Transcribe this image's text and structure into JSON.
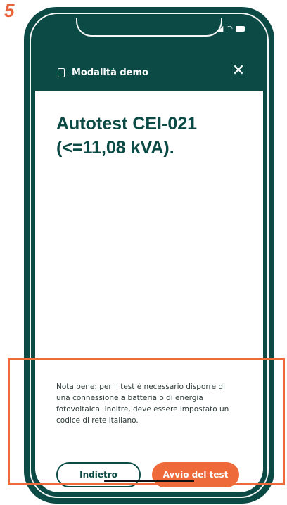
{
  "step": {
    "number": "5"
  },
  "header": {
    "icon": "document-icon",
    "label": "Modalità demo",
    "close_icon": "close-icon"
  },
  "main": {
    "title_line1": "Autotest CEI-021",
    "title_line2": "(<=11,08 kVA).",
    "note": "Nota bene: per il test è necessario disporre di una connessione a batteria o di energia fotovoltaica. Inoltre, deve essere impostato un codice di rete italiano."
  },
  "actions": {
    "back_label": "Indietro",
    "start_label": "Avvio del test"
  },
  "colors": {
    "brand_dark_green": "#0c4a45",
    "accent_orange": "#ef6a3a",
    "background": "#ffffff"
  }
}
